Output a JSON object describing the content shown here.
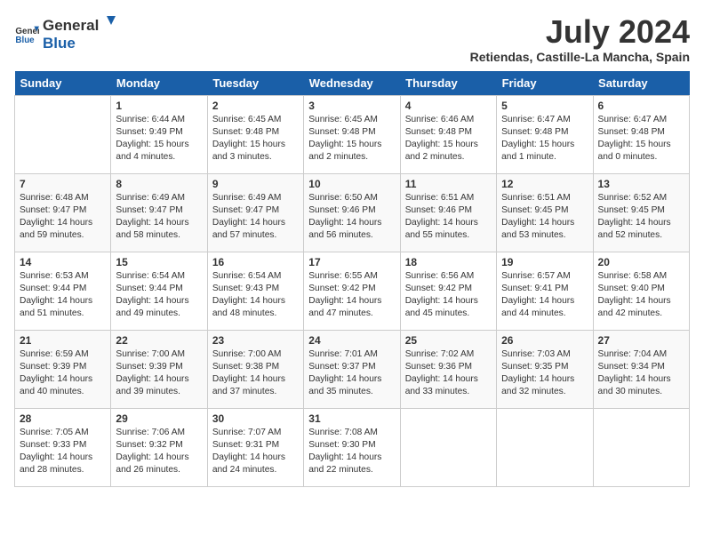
{
  "header": {
    "logo_general": "General",
    "logo_blue": "Blue",
    "month_year": "July 2024",
    "location": "Retiendas, Castille-La Mancha, Spain"
  },
  "days_of_week": [
    "Sunday",
    "Monday",
    "Tuesday",
    "Wednesday",
    "Thursday",
    "Friday",
    "Saturday"
  ],
  "weeks": [
    [
      {
        "day": "",
        "content": ""
      },
      {
        "day": "1",
        "content": "Sunrise: 6:44 AM\nSunset: 9:49 PM\nDaylight: 15 hours\nand 4 minutes."
      },
      {
        "day": "2",
        "content": "Sunrise: 6:45 AM\nSunset: 9:48 PM\nDaylight: 15 hours\nand 3 minutes."
      },
      {
        "day": "3",
        "content": "Sunrise: 6:45 AM\nSunset: 9:48 PM\nDaylight: 15 hours\nand 2 minutes."
      },
      {
        "day": "4",
        "content": "Sunrise: 6:46 AM\nSunset: 9:48 PM\nDaylight: 15 hours\nand 2 minutes."
      },
      {
        "day": "5",
        "content": "Sunrise: 6:47 AM\nSunset: 9:48 PM\nDaylight: 15 hours\nand 1 minute."
      },
      {
        "day": "6",
        "content": "Sunrise: 6:47 AM\nSunset: 9:48 PM\nDaylight: 15 hours\nand 0 minutes."
      }
    ],
    [
      {
        "day": "7",
        "content": "Sunrise: 6:48 AM\nSunset: 9:47 PM\nDaylight: 14 hours\nand 59 minutes."
      },
      {
        "day": "8",
        "content": "Sunrise: 6:49 AM\nSunset: 9:47 PM\nDaylight: 14 hours\nand 58 minutes."
      },
      {
        "day": "9",
        "content": "Sunrise: 6:49 AM\nSunset: 9:47 PM\nDaylight: 14 hours\nand 57 minutes."
      },
      {
        "day": "10",
        "content": "Sunrise: 6:50 AM\nSunset: 9:46 PM\nDaylight: 14 hours\nand 56 minutes."
      },
      {
        "day": "11",
        "content": "Sunrise: 6:51 AM\nSunset: 9:46 PM\nDaylight: 14 hours\nand 55 minutes."
      },
      {
        "day": "12",
        "content": "Sunrise: 6:51 AM\nSunset: 9:45 PM\nDaylight: 14 hours\nand 53 minutes."
      },
      {
        "day": "13",
        "content": "Sunrise: 6:52 AM\nSunset: 9:45 PM\nDaylight: 14 hours\nand 52 minutes."
      }
    ],
    [
      {
        "day": "14",
        "content": "Sunrise: 6:53 AM\nSunset: 9:44 PM\nDaylight: 14 hours\nand 51 minutes."
      },
      {
        "day": "15",
        "content": "Sunrise: 6:54 AM\nSunset: 9:44 PM\nDaylight: 14 hours\nand 49 minutes."
      },
      {
        "day": "16",
        "content": "Sunrise: 6:54 AM\nSunset: 9:43 PM\nDaylight: 14 hours\nand 48 minutes."
      },
      {
        "day": "17",
        "content": "Sunrise: 6:55 AM\nSunset: 9:42 PM\nDaylight: 14 hours\nand 47 minutes."
      },
      {
        "day": "18",
        "content": "Sunrise: 6:56 AM\nSunset: 9:42 PM\nDaylight: 14 hours\nand 45 minutes."
      },
      {
        "day": "19",
        "content": "Sunrise: 6:57 AM\nSunset: 9:41 PM\nDaylight: 14 hours\nand 44 minutes."
      },
      {
        "day": "20",
        "content": "Sunrise: 6:58 AM\nSunset: 9:40 PM\nDaylight: 14 hours\nand 42 minutes."
      }
    ],
    [
      {
        "day": "21",
        "content": "Sunrise: 6:59 AM\nSunset: 9:39 PM\nDaylight: 14 hours\nand 40 minutes."
      },
      {
        "day": "22",
        "content": "Sunrise: 7:00 AM\nSunset: 9:39 PM\nDaylight: 14 hours\nand 39 minutes."
      },
      {
        "day": "23",
        "content": "Sunrise: 7:00 AM\nSunset: 9:38 PM\nDaylight: 14 hours\nand 37 minutes."
      },
      {
        "day": "24",
        "content": "Sunrise: 7:01 AM\nSunset: 9:37 PM\nDaylight: 14 hours\nand 35 minutes."
      },
      {
        "day": "25",
        "content": "Sunrise: 7:02 AM\nSunset: 9:36 PM\nDaylight: 14 hours\nand 33 minutes."
      },
      {
        "day": "26",
        "content": "Sunrise: 7:03 AM\nSunset: 9:35 PM\nDaylight: 14 hours\nand 32 minutes."
      },
      {
        "day": "27",
        "content": "Sunrise: 7:04 AM\nSunset: 9:34 PM\nDaylight: 14 hours\nand 30 minutes."
      }
    ],
    [
      {
        "day": "28",
        "content": "Sunrise: 7:05 AM\nSunset: 9:33 PM\nDaylight: 14 hours\nand 28 minutes."
      },
      {
        "day": "29",
        "content": "Sunrise: 7:06 AM\nSunset: 9:32 PM\nDaylight: 14 hours\nand 26 minutes."
      },
      {
        "day": "30",
        "content": "Sunrise: 7:07 AM\nSunset: 9:31 PM\nDaylight: 14 hours\nand 24 minutes."
      },
      {
        "day": "31",
        "content": "Sunrise: 7:08 AM\nSunset: 9:30 PM\nDaylight: 14 hours\nand 22 minutes."
      },
      {
        "day": "",
        "content": ""
      },
      {
        "day": "",
        "content": ""
      },
      {
        "day": "",
        "content": ""
      }
    ]
  ]
}
